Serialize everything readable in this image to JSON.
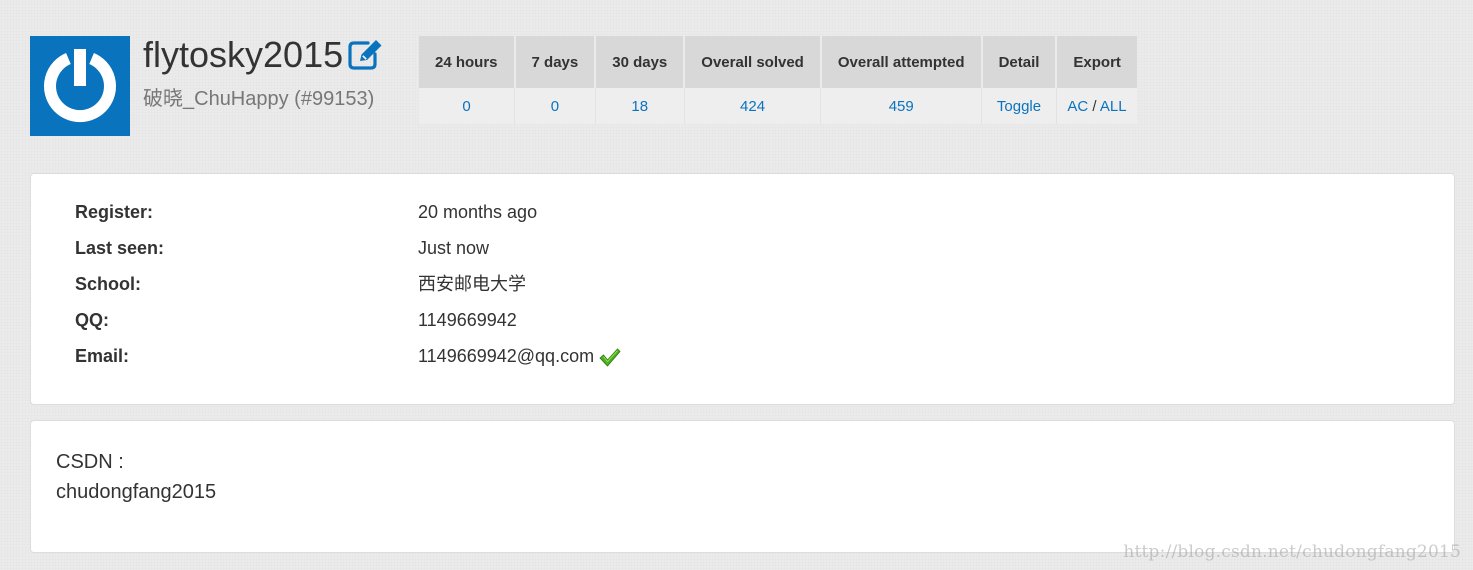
{
  "profile": {
    "username": "flytosky2015",
    "nickname": "破晓_ChuHappy (#99153)",
    "avatar_icon": "power-icon",
    "edit_icon": "edit-icon",
    "accent_color": "#0a73be"
  },
  "stats": {
    "headers": [
      "24 hours",
      "7 days",
      "30 days",
      "Overall solved",
      "Overall attempted",
      "Detail",
      "Export"
    ],
    "values": {
      "h24": "0",
      "d7": "0",
      "d30": "18",
      "overall_solved": "424",
      "overall_attempted": "459",
      "detail": "Toggle",
      "export_ac": "AC",
      "export_sep": "/",
      "export_all": "ALL"
    }
  },
  "info": {
    "rows": [
      {
        "label": "Register:",
        "value": "20 months ago"
      },
      {
        "label": "Last seen:",
        "value": "Just now"
      },
      {
        "label": "School:",
        "value": "西安邮电大学"
      },
      {
        "label": "QQ:",
        "value": "1149669942"
      },
      {
        "label": "Email:",
        "value": "1149669942@qq.com"
      }
    ],
    "email_verified_icon": "check-icon"
  },
  "bio": {
    "line1": "CSDN :",
    "line2": "chudongfang2015"
  },
  "watermark": "http://blog.csdn.net/chudongfang2015"
}
